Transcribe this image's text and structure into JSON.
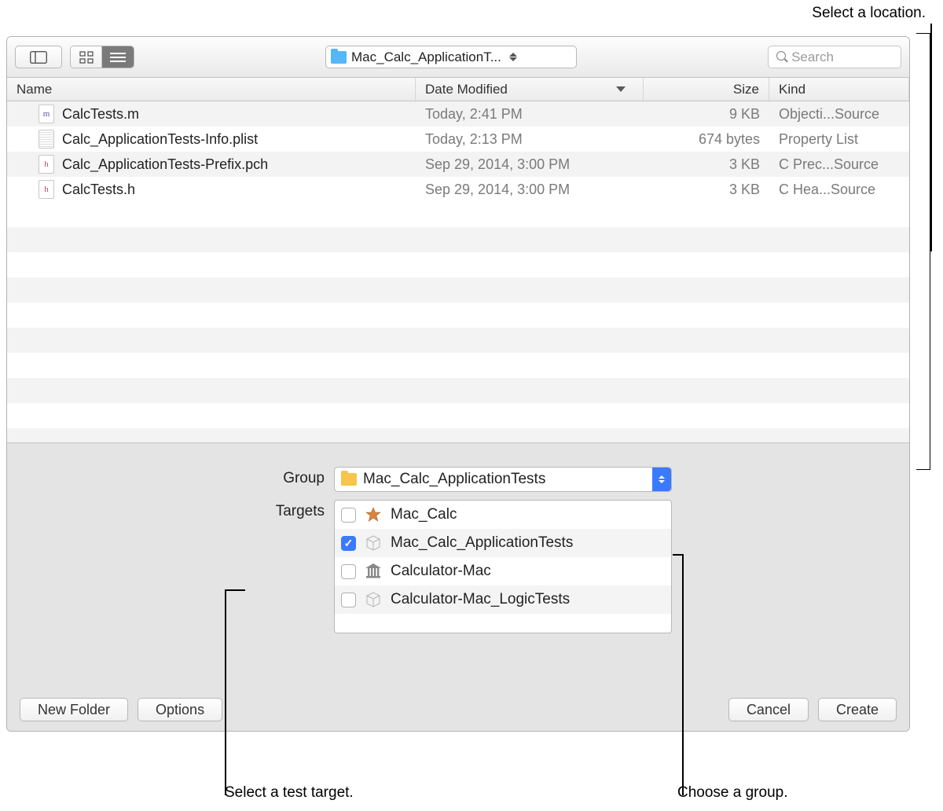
{
  "annotations": {
    "top": "Select a location.",
    "bottom_left": "Select a test target.",
    "bottom_right": "Choose a group."
  },
  "toolbar": {
    "path_label": "Mac_Calc_ApplicationT...",
    "search_placeholder": "Search"
  },
  "columns": {
    "name": "Name",
    "date": "Date Modified",
    "size": "Size",
    "kind": "Kind"
  },
  "files": [
    {
      "icon": "m",
      "icon_letter": "m",
      "name": "CalcTests.m",
      "date": "Today, 2:41 PM",
      "size": "9 KB",
      "kind": "Objecti...Source"
    },
    {
      "icon": "plist",
      "icon_letter": "",
      "name": "Calc_ApplicationTests-Info.plist",
      "date": "Today, 2:13 PM",
      "size": "674 bytes",
      "kind": "Property List"
    },
    {
      "icon": "h",
      "icon_letter": "h",
      "name": "Calc_ApplicationTests-Prefix.pch",
      "date": "Sep 29, 2014, 3:00 PM",
      "size": "3 KB",
      "kind": "C Prec...Source"
    },
    {
      "icon": "h",
      "icon_letter": "h",
      "name": "CalcTests.h",
      "date": "Sep 29, 2014, 3:00 PM",
      "size": "3 KB",
      "kind": "C Hea...Source"
    }
  ],
  "form": {
    "group_label": "Group",
    "targets_label": "Targets",
    "group_value": "Mac_Calc_ApplicationTests"
  },
  "targets": [
    {
      "checked": false,
      "icon": "app",
      "name": "Mac_Calc"
    },
    {
      "checked": true,
      "icon": "bundle",
      "name": "Mac_Calc_ApplicationTests"
    },
    {
      "checked": false,
      "icon": "library",
      "name": "Calculator-Mac"
    },
    {
      "checked": false,
      "icon": "bundle",
      "name": "Calculator-Mac_LogicTests"
    }
  ],
  "buttons": {
    "new_folder": "New Folder",
    "options": "Options",
    "cancel": "Cancel",
    "create": "Create"
  }
}
